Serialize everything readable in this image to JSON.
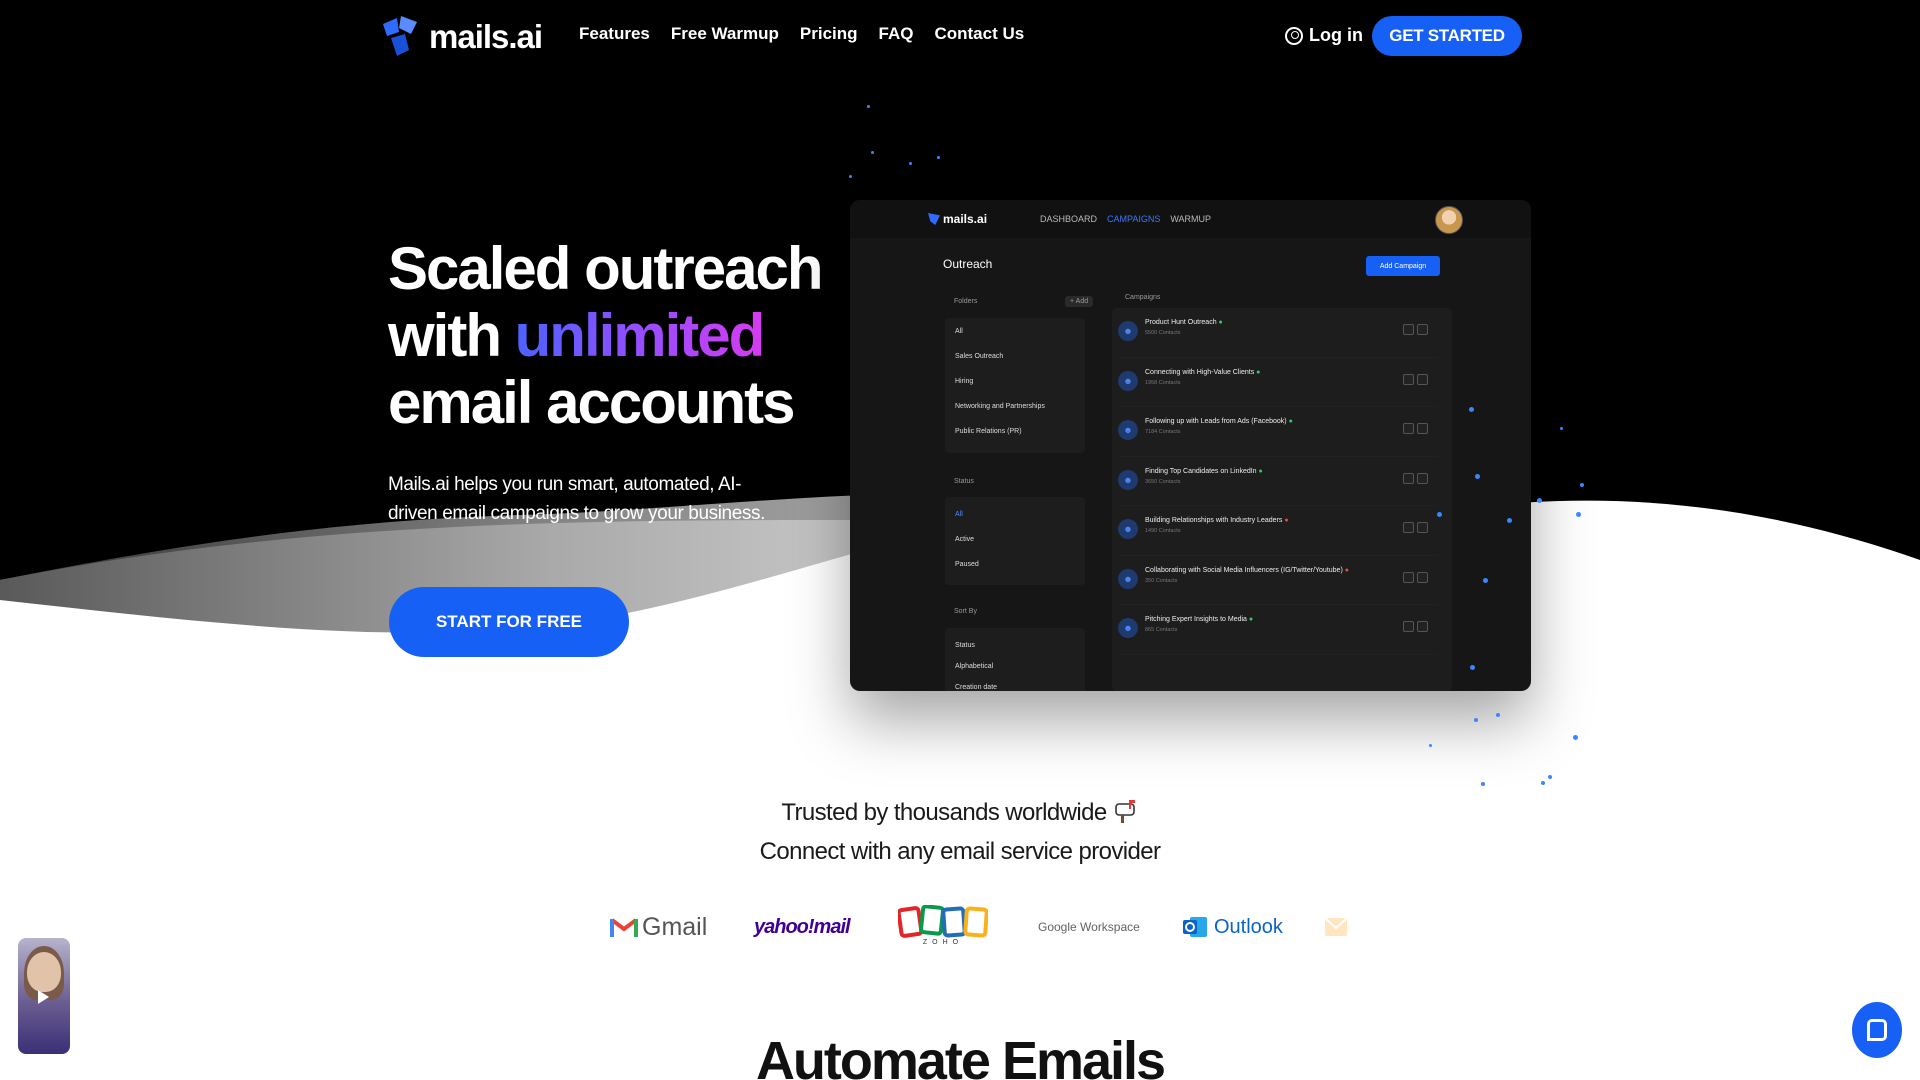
{
  "nav": {
    "logo_text": "mails.ai",
    "links": [
      "Features",
      "Free Warmup",
      "Pricing",
      "FAQ",
      "Contact Us"
    ],
    "login_label": "Log in",
    "cta_label": "GET STARTED"
  },
  "hero": {
    "title_line1": "Scaled outreach",
    "title_line2_pre": "with ",
    "title_line2_highlight": "unlimited",
    "title_line3": "email accounts",
    "subtitle": "Mails.ai helps you run smart, automated, AI-driven email campaigns to grow your business.",
    "cta_label": "START FOR FREE"
  },
  "mock": {
    "logo_text": "mails.ai",
    "nav": [
      "DASHBOARD",
      "CAMPAIGNS",
      "WARMUP"
    ],
    "heading": "Outreach",
    "add_campaign_label": "Add Campaign",
    "folders_label": "Folders",
    "add_label": "+ Add",
    "folders": [
      "All",
      "Sales Outreach",
      "Hiring",
      "Networking and Partnerships",
      "Public Relations (PR)"
    ],
    "status_label": "Status",
    "statuses": [
      "All",
      "Active",
      "Paused"
    ],
    "sort_label": "Sort By",
    "sorts": [
      "Status",
      "Alphabetical",
      "Creation date"
    ],
    "campaigns_label": "Campaigns",
    "campaigns": [
      {
        "name": "Product Hunt Outreach",
        "count": "5500 Contacts"
      },
      {
        "name": "Connecting with High-Value Clients",
        "count": "1958 Contacts"
      },
      {
        "name": "Following up with Leads from Ads (Facebook)",
        "count": "7184 Contacts"
      },
      {
        "name": "Finding Top Candidates on LinkedIn",
        "count": "3650 Contacts"
      },
      {
        "name": "Building Relationships with Industry Leaders",
        "count": "1490 Contacts"
      },
      {
        "name": "Collaborating with Social Media Influencers (IG/Twitter/Youtube)",
        "count": "350 Contacts"
      },
      {
        "name": "Pitching Expert Insights to Media",
        "count": "865 Contacts"
      }
    ]
  },
  "trusted": {
    "line1": "Trusted by thousands worldwide",
    "line2": "Connect with any email service provider"
  },
  "providers": {
    "gmail": "Gmail",
    "yahoo": "yahoo!mail",
    "zoho": "ZOHO",
    "google_workspace": "Google Workspace",
    "outlook": "Outlook"
  },
  "section": {
    "heading": "Automate Emails"
  },
  "colors": {
    "accent": "#1760f5",
    "hero_bg": "#000000",
    "gradient_start": "#4b63ff",
    "gradient_end": "#d63bf0"
  }
}
